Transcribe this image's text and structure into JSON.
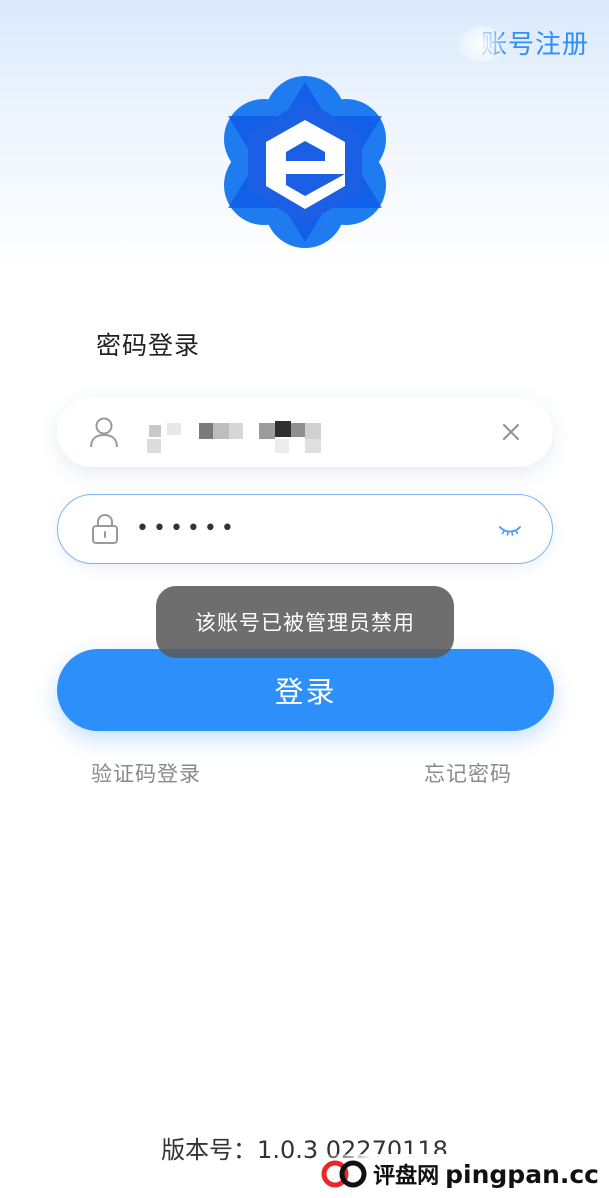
{
  "header": {
    "register_label": "账号注册"
  },
  "login": {
    "mode_title": "密码登录",
    "username_value": "",
    "password_value": "••••••",
    "login_button": "登录",
    "sms_login_link": "验证码登录",
    "forgot_password_link": "忘记密码"
  },
  "toast": {
    "message": "该账号已被管理员禁用"
  },
  "footer": {
    "version": "版本号：1.0.3 02270118"
  },
  "watermark": {
    "site_name": "评盘网",
    "site_url": "pingpan.cc"
  },
  "icons": {
    "user": "user-icon",
    "lock": "lock-icon",
    "clear": "close-icon",
    "eye": "eye-closed-icon"
  },
  "colors": {
    "accent": "#2d8ffa",
    "link_blue": "#2f8ff4",
    "toast_bg": "#5a5a5a",
    "sub_link": "#8a8a8a"
  }
}
